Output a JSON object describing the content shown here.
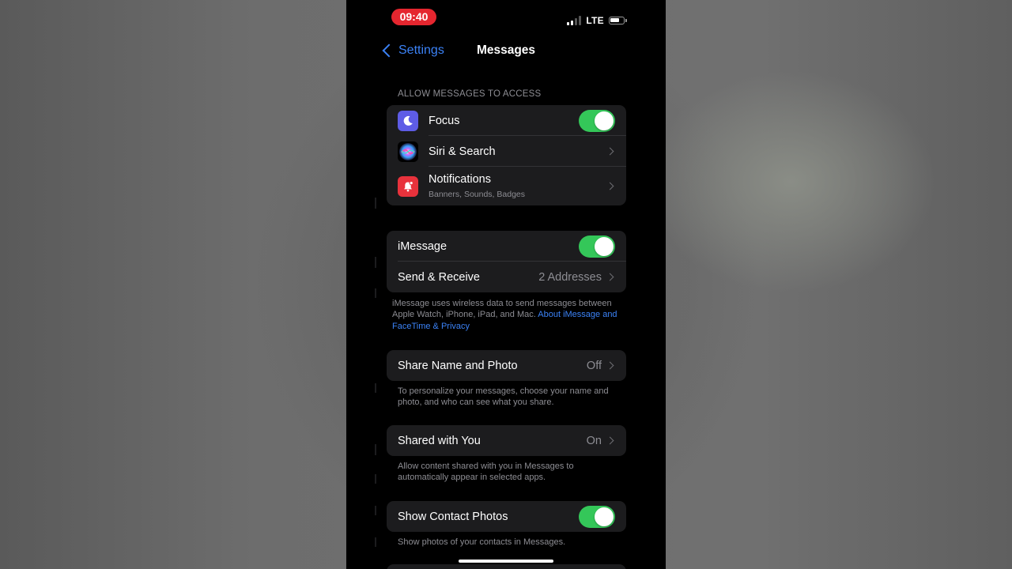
{
  "status_bar": {
    "time": "09:40",
    "network": "LTE"
  },
  "nav": {
    "back_label": "Settings",
    "title": "Messages"
  },
  "access_section": {
    "header": "ALLOW MESSAGES TO ACCESS",
    "items": [
      {
        "label": "Focus",
        "icon": "moon-icon",
        "icon_color": "#5e5ce6",
        "control": "toggle",
        "on": true
      },
      {
        "label": "Siri & Search",
        "icon": "siri-icon",
        "control": "chevron"
      },
      {
        "label": "Notifications",
        "sublabel": "Banners, Sounds, Badges",
        "icon": "notification-bell-icon",
        "icon_color": "#e8323c",
        "control": "chevron"
      }
    ]
  },
  "imessage_section": {
    "items": [
      {
        "label": "iMessage",
        "control": "toggle",
        "on": true
      },
      {
        "label": "Send & Receive",
        "value": "2 Addresses",
        "control": "chevron"
      }
    ],
    "footer_text": "iMessage uses wireless data to send messages between Apple Watch, iPhone, iPad, and Mac.",
    "footer_link": "About iMessage and FaceTime & Privacy"
  },
  "share_name_section": {
    "label": "Share Name and Photo",
    "value": "Off",
    "footer": "To personalize your messages, choose your name and photo, and who can see what you share."
  },
  "shared_with_you_section": {
    "label": "Shared with You",
    "value": "On",
    "footer": "Allow content shared with you in Messages to automatically appear in selected apps."
  },
  "contact_photos_section": {
    "label": "Show Contact Photos",
    "on": true,
    "footer": "Show photos of your contacts in Messages."
  },
  "colors": {
    "accent_blue": "#3b82f6",
    "toggle_green": "#34c759",
    "time_pill": "#e5262f",
    "cell_bg": "#1c1c1e"
  }
}
